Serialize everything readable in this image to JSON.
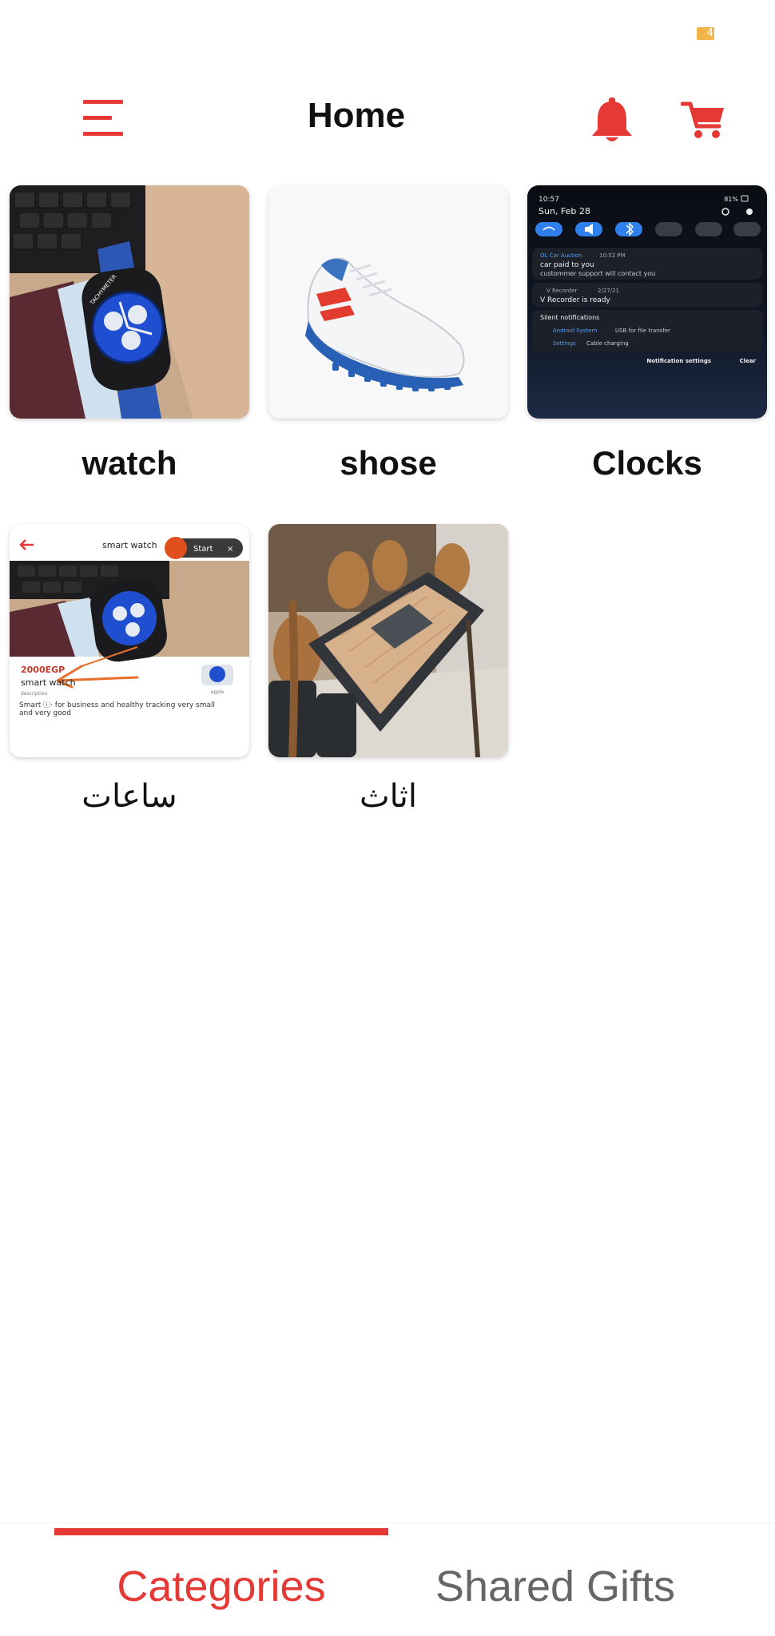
{
  "status_bar": {
    "battery_level": "4"
  },
  "header": {
    "title": "Home",
    "menu_icon": "hamburger-menu-icon",
    "notification_icon": "bell-icon",
    "cart_icon": "shopping-cart-icon"
  },
  "categories": [
    {
      "label": "watch",
      "image": {
        "kind": "photo",
        "dial_text": "TACHYMETER"
      }
    },
    {
      "label": "shose",
      "image": {
        "kind": "photo"
      }
    },
    {
      "label": "Clocks",
      "image": {
        "kind": "screenshot",
        "time": "10:57",
        "date": "Sun, Feb 28",
        "battery": "81%",
        "n1_app": "OL Car Auction",
        "n1_time": "10:52 PM",
        "n1_title": "car paid to you",
        "n1_text": "custommer support will contact you",
        "n2_app": "V Recorder",
        "n2_time": "2/27/21",
        "n2_title": "V Recorder is ready",
        "silent_label": "Silent notifications",
        "s1_app": "Android System",
        "s1_text": "USB for file transfer",
        "s2_app": "Settings",
        "s2_text": "Cable charging",
        "btn_settings": "Notification settings",
        "btn_clear": "Clear"
      }
    },
    {
      "label": "ساعات",
      "image": {
        "kind": "screenshot",
        "title": "smart watch",
        "record_btn": "Start",
        "price": "2000EGP",
        "name": "smart watch",
        "desc_label": "description",
        "brand": "apple",
        "desc": "Smart ⓘ· for business and healthy tracking very small and very good"
      }
    },
    {
      "label": "اثاث",
      "image": {
        "kind": "photo"
      }
    }
  ],
  "bottom_nav": {
    "tabs": [
      {
        "label": "Categories",
        "active": true
      },
      {
        "label": "Shared Gifts",
        "active": false
      }
    ],
    "accent_color": "#e53935",
    "inactive_color": "#666666"
  }
}
